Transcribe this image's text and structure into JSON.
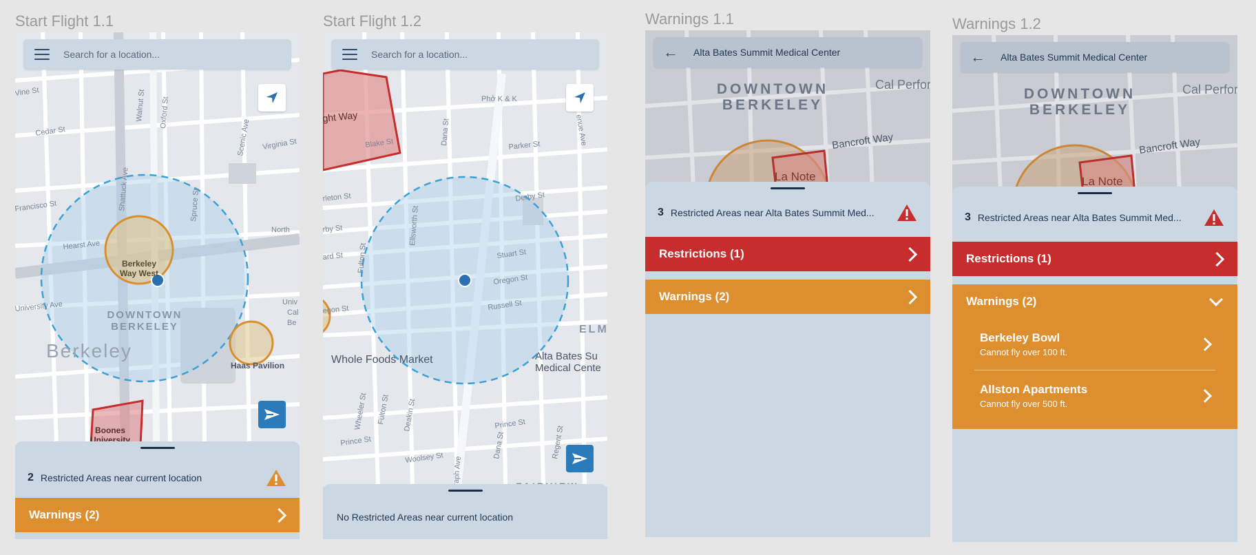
{
  "frames": [
    {
      "title": "Start Flight 1.1",
      "search_placeholder": "Search for a location...",
      "map_labels": [
        "Berkeley Way West",
        "DOWNTOWN",
        "BERKELEY",
        "Berkeley",
        "Haas Pavilion",
        "Boones University",
        "Cedar St",
        "Virginia St",
        "Hearst Ave",
        "University Ave",
        "Shattuck Ave",
        "Oxford St",
        "Scenic Ave",
        "Spruce St",
        "Walnut St",
        "Francisco St",
        "Vine St",
        "North",
        "Univ Cal Be"
      ],
      "restricted_count": "2",
      "restricted_text": "Restricted Areas near current location",
      "warnings_label": "Warnings (2)"
    },
    {
      "title": "Start Flight 1.2",
      "search_placeholder": "Search for a location...",
      "map_labels": [
        "ght Way",
        "Blake St",
        "Phở K & K",
        "Parker St",
        "Derby St",
        "Stuart St",
        "Oregon St",
        "Russell St",
        "Ellsworth St",
        "Fulton St",
        "Dana St",
        "Whole Foods Market",
        "Alta Bates Su Medical Cente",
        "Wheeler St",
        "Deakin St",
        "Prince St",
        "Woolsey St",
        "Regent St",
        "ELM",
        "FAIRVIEW",
        "Telegraph Ave",
        "rleton St",
        "rby St",
        "ard St",
        "egon St",
        "enue Ave"
      ],
      "status_text": "No Restricted Areas near current location"
    },
    {
      "title": "Warnings 1.1",
      "location_title": "Alta Bates Summit Medical Center",
      "map_labels": [
        "DOWNTOWN",
        "BERKELEY",
        "Cal Perfor",
        "Bancroft Way",
        "La Note"
      ],
      "restricted_count": "3",
      "restricted_text": "Restricted Areas near Alta Bates Summit Med...",
      "restrictions_label": "Restrictions (1)",
      "warnings_label": "Warnings (2)"
    },
    {
      "title": "Warnings 1.2",
      "location_title": "Alta Bates Summit Medical Center",
      "map_labels": [
        "DOWNTOWN",
        "BERKELEY",
        "Cal Perfor",
        "Bancroft Way",
        "La Note"
      ],
      "restricted_count": "3",
      "restricted_text": "Restricted Areas near Alta Bates Summit Med...",
      "restrictions_label": "Restrictions (1)",
      "warnings_label": "Warnings (2)",
      "warnings_items": [
        {
          "name": "Berkeley Bowl",
          "desc": "Cannot fly over 100 ft."
        },
        {
          "name": "Allston Apartments",
          "desc": "Cannot fly over 500 ft."
        }
      ]
    }
  ],
  "icons": {
    "menu": "hamburger-menu-icon",
    "back": "arrow-left-icon",
    "locate": "navigation-arrow-icon",
    "fly": "paper-plane-icon",
    "warning": "warning-triangle-icon",
    "chevron": "chevron-right-icon"
  },
  "colors": {
    "restriction": "#c62d2c",
    "warning": "#dd8e2e",
    "sheet": "#cbd8e4",
    "radius_circle": "#3ba0d6",
    "accent_blue": "#2b7bbb"
  }
}
